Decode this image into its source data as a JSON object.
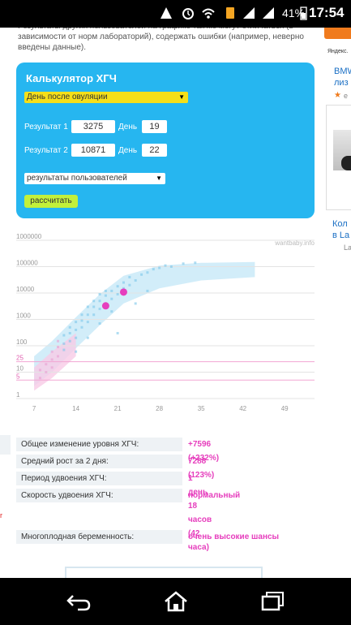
{
  "status_bar": {
    "battery_percent": "41%",
    "time": "17:54"
  },
  "intro_text": "Результаты других пользователей на графике так же могут отличаться (в зависимости от норм лабораторий), содержать ошибки (например, неверно введены данные).",
  "right_ad": {
    "label": "Яндекс.",
    "title_top": "BMW",
    "title_top_2": "лиз",
    "small": "e",
    "title_bottom": "Кол",
    "title_bottom_2": "в La",
    "small_bottom": "La"
  },
  "calculator": {
    "title": "Калькулятор ХГЧ",
    "day_select": "День после овуляции",
    "result1_label": "Результат 1",
    "result1_value": "3275",
    "day1_label": "День",
    "day1_value": "19",
    "result2_label": "Результат 2",
    "result2_value": "10871",
    "day2_label": "День",
    "day2_value": "22",
    "results_select": "результаты пользователей",
    "button": "рассчитать"
  },
  "chart_data": {
    "type": "scatter",
    "watermark": "wantbaby.info",
    "y_scale": "log",
    "ylim": [
      1,
      1000000
    ],
    "y_ticks": [
      "1000000",
      "100000",
      "10000",
      "1000",
      "100",
      "25",
      "10",
      "5",
      "1"
    ],
    "x_ticks": [
      "7",
      "14",
      "21",
      "28",
      "35",
      "42",
      "49"
    ],
    "xlim": [
      4,
      54
    ],
    "grid": true,
    "highlight_points": [
      {
        "x": 19,
        "y": 3275
      },
      {
        "x": 22,
        "y": 10871
      }
    ]
  },
  "stats": [
    {
      "label": "Общее изменение уровня ХГЧ:",
      "value": "+7596 (+232%)"
    },
    {
      "label": "Средний рост за 2 дня:",
      "value": "7288 (123%)"
    },
    {
      "label": "Период удвоения ХГЧ:",
      "value": "1 день 18 часов (42 часа)"
    },
    {
      "label": "Скорость удвоения ХГЧ:",
      "value": "нормальный"
    }
  ],
  "multiple": {
    "label": "Многоплодная беременность:",
    "value": "очень высокие шансы"
  },
  "colors": {
    "calc_bg": "#26b6f0",
    "select_yellow": "#f5df19",
    "button_green": "#c3f03a",
    "accent_pink": "#e63ebd",
    "band_blue": "#bfe6f7"
  }
}
